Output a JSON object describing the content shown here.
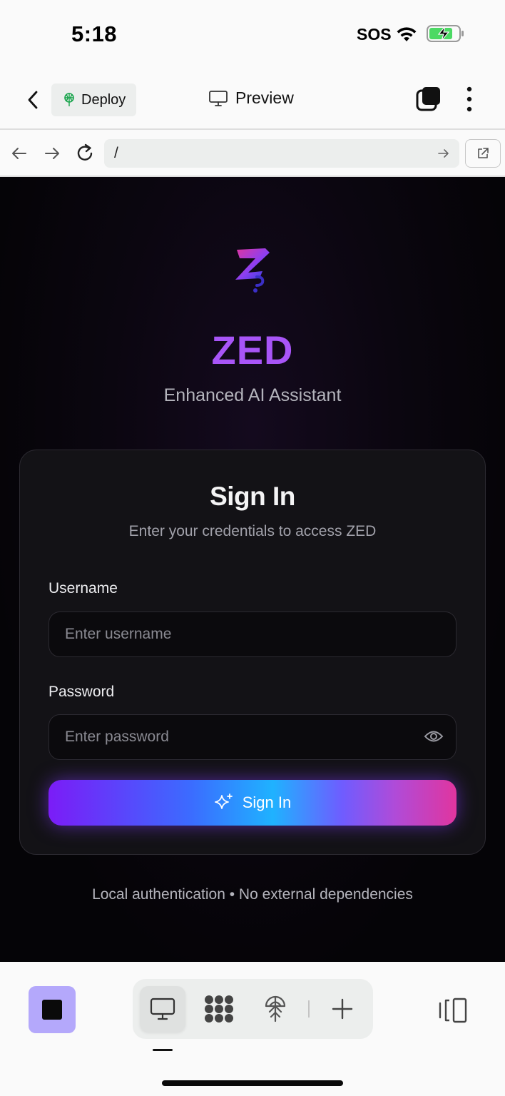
{
  "status_bar": {
    "time": "5:18",
    "carrier": "SOS",
    "icons": [
      "wifi-icon",
      "battery-charging-icon"
    ],
    "battery_color": "#4cd964"
  },
  "header": {
    "back_icon": "chevron-left-icon",
    "deploy_label": "Deploy",
    "deploy_icon": "deploy-tree-icon",
    "deploy_icon_color": "#16a34a",
    "preview_label": "Preview",
    "preview_icon": "monitor-icon",
    "tabs_icon": "stacked-squares-icon",
    "more_icon": "vertical-dots-icon"
  },
  "browser": {
    "back_icon": "arrow-left-icon",
    "forward_icon": "arrow-right-icon",
    "reload_icon": "reload-icon",
    "url": "/",
    "go_icon": "arrow-right-icon",
    "open_external_icon": "external-link-icon"
  },
  "app": {
    "logo_icon": "zed-logo-icon",
    "title": "ZED",
    "subtitle": "Enhanced AI Assistant",
    "accent_color": "#a855f7",
    "card": {
      "title": "Sign In",
      "description": "Enter your credentials to access ZED",
      "username_label": "Username",
      "username_placeholder": "Enter username",
      "username_value": "",
      "password_label": "Password",
      "password_placeholder": "Enter password",
      "password_value": "",
      "password_toggle_icon": "eye-icon",
      "submit_label": "Sign In",
      "submit_icon": "sparkles-icon"
    },
    "footer": "Local authentication • No external dependencies"
  },
  "toolbar": {
    "stop_icon": "stop-icon",
    "stop_color": "#b4a8fb",
    "tools": [
      {
        "icon": "monitor-icon",
        "active": true
      },
      {
        "icon": "dots-grid-icon",
        "active": false
      },
      {
        "icon": "deploy-tree-icon",
        "active": false
      },
      {
        "icon": "plus-icon",
        "active": false
      }
    ],
    "layout_icon": "split-panel-icon"
  }
}
